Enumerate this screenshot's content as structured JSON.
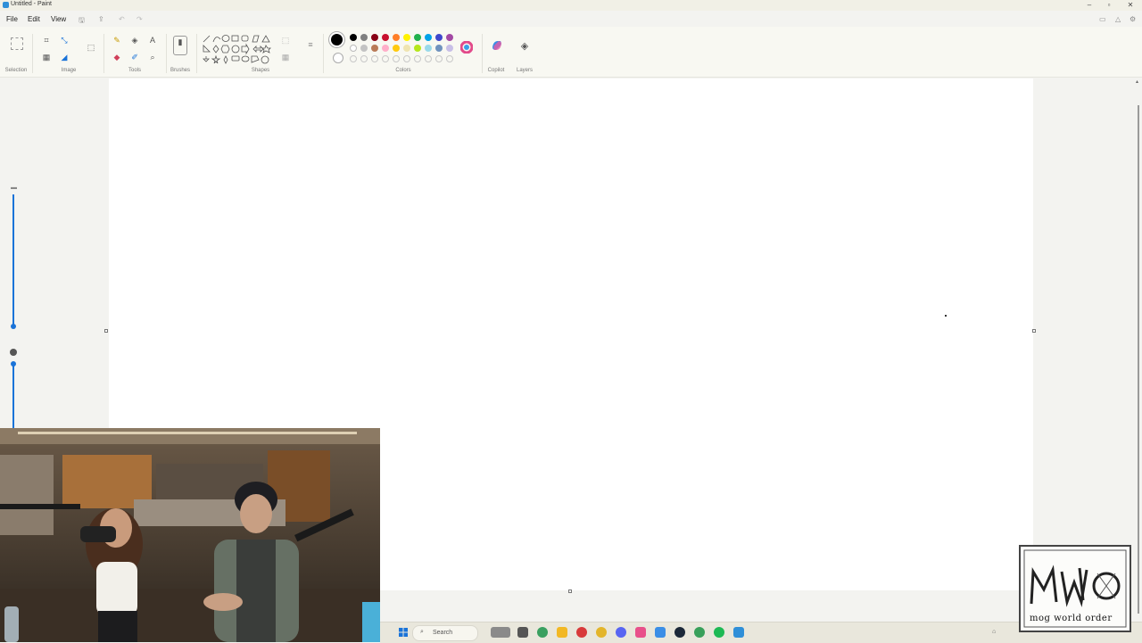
{
  "window": {
    "title": "Untitled - Paint"
  },
  "menu": {
    "file": "File",
    "edit": "Edit",
    "view": "View"
  },
  "ribbon": {
    "groups": {
      "selection": "Selection",
      "image": "Image",
      "tools": "Tools",
      "brushes": "Brushes",
      "shapes": "Shapes",
      "colors": "Colors",
      "copilot": "Copilot",
      "layers": "Layers"
    },
    "colors": {
      "row1": [
        "#000000",
        "#7f7f7f",
        "#880015",
        "#c8102e",
        "#ff7f27",
        "#fff200",
        "#22b14c",
        "#00a2e8",
        "#3f48cc",
        "#a349a4"
      ],
      "row2": [
        "#ffffff",
        "#c3c3c3",
        "#b97a57",
        "#ffaec9",
        "#ffc90e",
        "#efe4b0",
        "#b5e61d",
        "#99d9ea",
        "#7092be",
        "#c8bfe7"
      ]
    },
    "primary_color": "#000000"
  },
  "canvas": {
    "background": "#ffffff"
  },
  "zoom_slider": {
    "level": 0.05
  },
  "taskbar": {
    "search_placeholder": "Search"
  },
  "overlay": {
    "watermark_text": "mog world order"
  }
}
